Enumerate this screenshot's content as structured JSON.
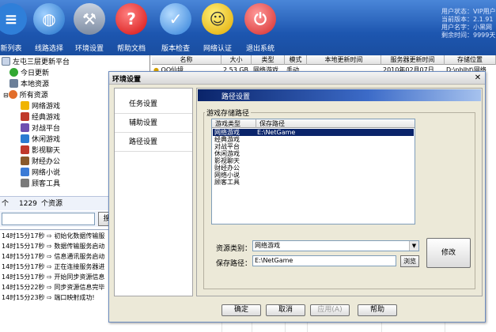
{
  "toolbar": {
    "buttons": [
      {
        "label": "新列表",
        "icon": "list-icon",
        "color": "#2f7fd9"
      },
      {
        "label": "线路选择",
        "icon": "globe-icon",
        "color": "#1f6fc8"
      },
      {
        "label": "环境设置",
        "icon": "tools-icon",
        "color": "#8b9bb3"
      },
      {
        "label": "帮助文档",
        "icon": "help-search-icon",
        "color": "#e02020"
      },
      {
        "label": "版本检查",
        "icon": "globe-check-icon",
        "color": "#3d8fe0"
      },
      {
        "label": "网络认证",
        "icon": "smiley-icon",
        "color": "#f2c200"
      },
      {
        "label": "退出系统",
        "icon": "power-icon",
        "color": "#e54040"
      }
    ],
    "status": [
      "用户状态：VIP用户",
      "当前版本：2.1.91",
      "用户名字：小黑网",
      "剩余时间：9999天"
    ]
  },
  "tree": {
    "root": "左屯三层更新平台",
    "items": [
      {
        "label": "今日更新",
        "icon": "check-icon",
        "color": "#32a832"
      },
      {
        "label": "本地资源",
        "icon": "computer-icon",
        "color": "#6b7f99"
      },
      {
        "label": "所有资源",
        "icon": "resources-icon",
        "color": "#e26d2a"
      },
      {
        "label": "网络游戏",
        "icon": "star-icon",
        "color": "#f0b400"
      },
      {
        "label": "经典游戏",
        "icon": "cards-icon",
        "color": "#c0392b"
      },
      {
        "label": "对战平台",
        "icon": "swords-icon",
        "color": "#6f4fb0"
      },
      {
        "label": "休闲游戏",
        "icon": "phone-icon",
        "color": "#2b7bd1"
      },
      {
        "label": "影视聊天",
        "icon": "film-icon",
        "color": "#c0392b"
      },
      {
        "label": "财经办公",
        "icon": "book-icon",
        "color": "#8a5a2b"
      },
      {
        "label": "网络小说",
        "icon": "novel-icon",
        "color": "#3b7bd6"
      },
      {
        "label": "顾客工具",
        "icon": "tools-icon",
        "color": "#7a7a7a"
      }
    ]
  },
  "resource_count": {
    "prefix": "个",
    "count": "1229",
    "suffix": "个资源"
  },
  "search": {
    "button_label": "搜"
  },
  "log": [
    {
      "time": "14时15分17秒",
      "msg": "初始化数据传输服"
    },
    {
      "time": "14时15分17秒",
      "msg": "数据传输服务启动"
    },
    {
      "time": "14时15分17秒",
      "msg": "信息通讯服务启动"
    },
    {
      "time": "14时15分17秒",
      "msg": "正在连接服务器进"
    },
    {
      "time": "14时15分17秒",
      "msg": "开始同步资源信息"
    },
    {
      "time": "14时15分22秒",
      "msg": "同步资源信息完毕"
    },
    {
      "time": "14时15分23秒",
      "msg": "端口映射成功!"
    }
  ],
  "table": {
    "headers": [
      "名称",
      "大小",
      "类型",
      "模式",
      "本地更新时间",
      "服务器更新时间",
      "存储位置"
    ],
    "rows": [
      [
        "QQ仙境",
        "2.53 GB",
        "网络游戏",
        "手动",
        "",
        "2010年02月07日",
        "D:\\nblbt\\网络"
      ]
    ]
  },
  "dialog": {
    "title": "环境设置",
    "close_label": "✕",
    "nav": [
      "任务设置",
      "辅助设置",
      "路径设置"
    ],
    "panel_title": "路径设置",
    "group_label": "游戏存储路径",
    "list_headers": [
      "游戏类型",
      "保存路径"
    ],
    "list_rows": [
      {
        "type": "网络游戏",
        "path": "E:\\NetGame",
        "selected": true
      },
      {
        "type": "经典游戏",
        "path": "",
        "selected": false
      },
      {
        "type": "对战平台",
        "path": "",
        "selected": false
      },
      {
        "type": "休闲游戏",
        "path": "",
        "selected": false
      },
      {
        "type": "影视聊天",
        "path": "",
        "selected": false
      },
      {
        "type": "财经办公",
        "path": "",
        "selected": false
      },
      {
        "type": "网络小说",
        "path": "",
        "selected": false
      },
      {
        "type": "顾客工具",
        "path": "",
        "selected": false
      }
    ],
    "type_label": "资源类别：",
    "type_value": "网络游戏",
    "path_label": "保存路径：",
    "path_value": "E:\\NetGame",
    "browse_label": "浏览",
    "modify_label": "修改",
    "buttons": {
      "ok": "确定",
      "cancel": "取消",
      "apply": "应用(A)",
      "help": "帮助"
    }
  }
}
